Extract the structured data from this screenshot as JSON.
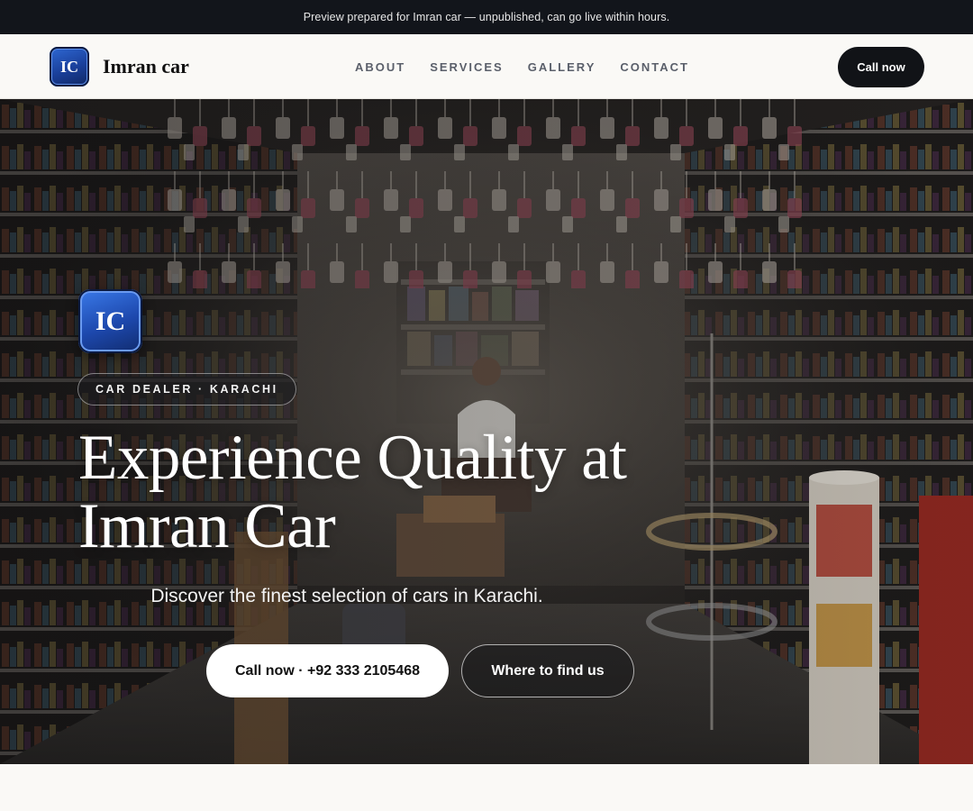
{
  "banner": {
    "text": "Preview prepared for Imran car — unpublished, can go live within hours."
  },
  "header": {
    "logo_initials": "IC",
    "brand_name": "Imran car",
    "nav": [
      "ABOUT",
      "SERVICES",
      "GALLERY",
      "CONTACT"
    ],
    "call_label": "Call now"
  },
  "hero": {
    "logo_initials": "IC",
    "tag": "CAR DEALER · KARACHI",
    "headline_line1": "Experience Quality at",
    "headline_line2": "Imran Car",
    "subhead": "Discover the finest selection of cars in Karachi.",
    "primary_cta": "Call now · +92 333 2105468",
    "secondary_cta": "Where to find us",
    "background_description_icon": "shop-interior-photo"
  },
  "colors": {
    "banner_bg": "#12151b",
    "logo_blue": "#1d48ad",
    "dark_button": "#111317",
    "page_bg": "#faf9f6"
  }
}
